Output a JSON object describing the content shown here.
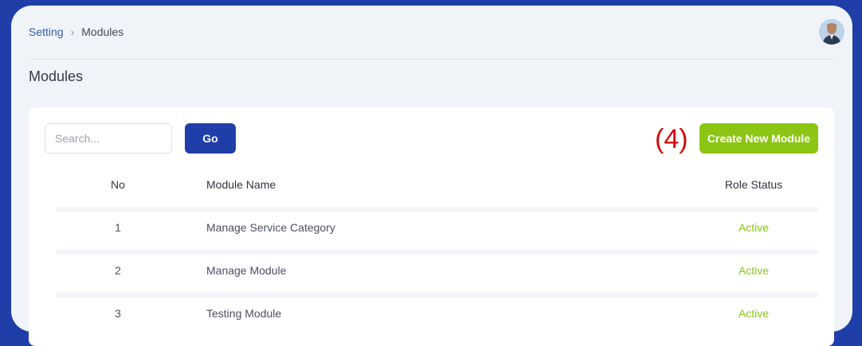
{
  "breadcrumb": {
    "parent": "Setting",
    "separator": "›",
    "current": "Modules"
  },
  "page": {
    "title": "Modules"
  },
  "toolbar": {
    "search_placeholder": "Search...",
    "go_label": "Go",
    "step_marker": "(4)",
    "create_label": "Create New Module"
  },
  "table": {
    "headers": {
      "no": "No",
      "name": "Module Name",
      "status": "Role Status"
    },
    "rows": [
      {
        "no": "1",
        "name": "Manage Service Category",
        "status": "Active"
      },
      {
        "no": "2",
        "name": "Manage Module",
        "status": "Active"
      },
      {
        "no": "3",
        "name": "Testing Module",
        "status": "Active"
      }
    ]
  },
  "colors": {
    "background": "#1f3ea8",
    "primary_button": "#1f3ea8",
    "create_button": "#8cc514",
    "status_active": "#8cc514",
    "step_marker": "#d30a0a"
  },
  "icons": {
    "avatar": "user-avatar-photo"
  }
}
